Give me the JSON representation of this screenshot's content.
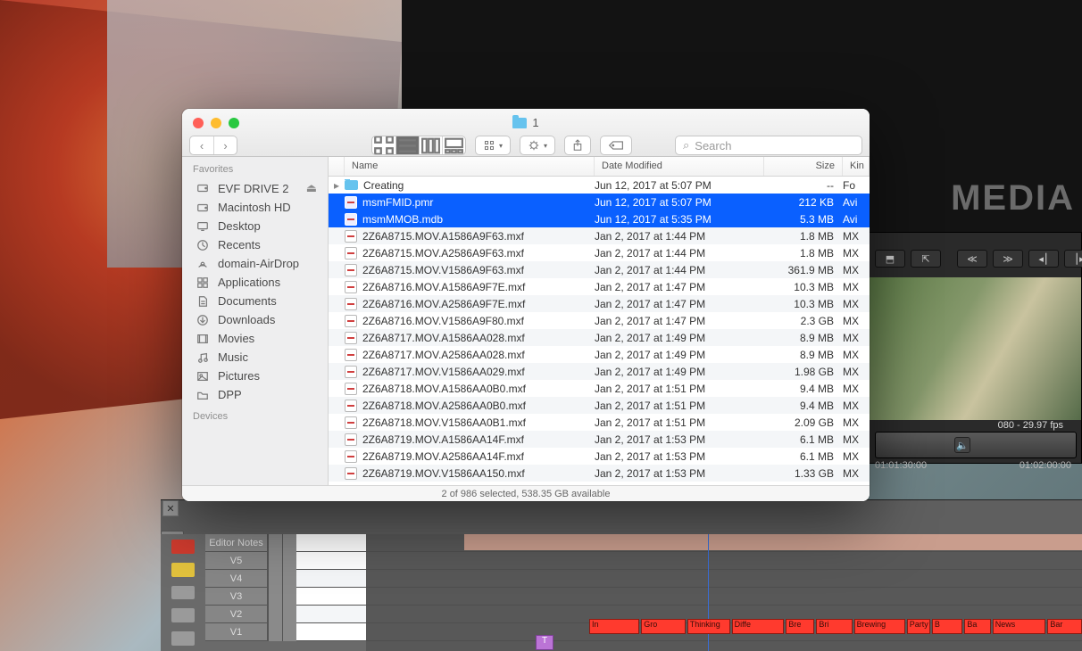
{
  "media_label": "MEDIA",
  "viewer": {
    "format": "080 - 29.97 fps",
    "tc_start": "01:01:30:00",
    "tc_end": "01:02:00:00",
    "speaker_icon": "🔈"
  },
  "timeline": {
    "notes_label": "Editor Notes",
    "tracks": [
      "V5",
      "V4",
      "V3",
      "V2",
      "V1"
    ],
    "clips": [
      "In",
      "Gro",
      "Thinking",
      "Diffe",
      "Bre",
      "Bri",
      "Brewing",
      "Party",
      "B",
      "Ba",
      "News",
      "Bar"
    ],
    "t_marker": "T"
  },
  "finder": {
    "title": "1",
    "search_placeholder": "Search",
    "nav": {
      "back": "‹",
      "fwd": "›"
    },
    "view_modes": {
      "icon_grid": "grid",
      "icon_list": "list",
      "icon_cols": "columns",
      "icon_gallery": "gallery"
    },
    "arrange_label": "Arrange",
    "action_label": "Action",
    "share_label": "Share",
    "tags_label": "Tags",
    "sidebar": {
      "favorites_label": "Favorites",
      "devices_label": "Devices",
      "items": [
        {
          "icon": "drive",
          "label": "EVF DRIVE 2",
          "eject": true
        },
        {
          "icon": "drive",
          "label": "Macintosh HD"
        },
        {
          "icon": "desktop",
          "label": "Desktop"
        },
        {
          "icon": "recents",
          "label": "Recents"
        },
        {
          "icon": "airdrop",
          "label": "domain-AirDrop"
        },
        {
          "icon": "apps",
          "label": "Applications"
        },
        {
          "icon": "docs",
          "label": "Documents"
        },
        {
          "icon": "downloads",
          "label": "Downloads"
        },
        {
          "icon": "movies",
          "label": "Movies"
        },
        {
          "icon": "music",
          "label": "Music"
        },
        {
          "icon": "pictures",
          "label": "Pictures"
        },
        {
          "icon": "folder",
          "label": "DPP"
        }
      ]
    },
    "columns": {
      "name": "Name",
      "date": "Date Modified",
      "size": "Size",
      "kind": "Kin"
    },
    "rows": [
      {
        "folder": true,
        "disclosure": true,
        "name": "Creating",
        "date": "Jun 12, 2017 at 5:07 PM",
        "size": "--",
        "kind": "Fo"
      },
      {
        "sel": true,
        "name": "msmFMID.pmr",
        "date": "Jun 12, 2017 at 5:07 PM",
        "size": "212 KB",
        "kind": "Avi"
      },
      {
        "sel": true,
        "name": "msmMMOB.mdb",
        "date": "Jun 12, 2017 at 5:35 PM",
        "size": "5.3 MB",
        "kind": "Avi"
      },
      {
        "name": "2Z6A8715.MOV.A1586A9F63.mxf",
        "date": "Jan 2, 2017 at 1:44 PM",
        "size": "1.8 MB",
        "kind": "MX"
      },
      {
        "name": "2Z6A8715.MOV.A2586A9F63.mxf",
        "date": "Jan 2, 2017 at 1:44 PM",
        "size": "1.8 MB",
        "kind": "MX"
      },
      {
        "name": "2Z6A8715.MOV.V1586A9F63.mxf",
        "date": "Jan 2, 2017 at 1:44 PM",
        "size": "361.9 MB",
        "kind": "MX"
      },
      {
        "name": "2Z6A8716.MOV.A1586A9F7E.mxf",
        "date": "Jan 2, 2017 at 1:47 PM",
        "size": "10.3 MB",
        "kind": "MX"
      },
      {
        "name": "2Z6A8716.MOV.A2586A9F7E.mxf",
        "date": "Jan 2, 2017 at 1:47 PM",
        "size": "10.3 MB",
        "kind": "MX"
      },
      {
        "name": "2Z6A8716.MOV.V1586A9F80.mxf",
        "date": "Jan 2, 2017 at 1:47 PM",
        "size": "2.3 GB",
        "kind": "MX"
      },
      {
        "name": "2Z6A8717.MOV.A1586AA028.mxf",
        "date": "Jan 2, 2017 at 1:49 PM",
        "size": "8.9 MB",
        "kind": "MX"
      },
      {
        "name": "2Z6A8717.MOV.A2586AA028.mxf",
        "date": "Jan 2, 2017 at 1:49 PM",
        "size": "8.9 MB",
        "kind": "MX"
      },
      {
        "name": "2Z6A8717.MOV.V1586AA029.mxf",
        "date": "Jan 2, 2017 at 1:49 PM",
        "size": "1.98 GB",
        "kind": "MX"
      },
      {
        "name": "2Z6A8718.MOV.A1586AA0B0.mxf",
        "date": "Jan 2, 2017 at 1:51 PM",
        "size": "9.4 MB",
        "kind": "MX"
      },
      {
        "name": "2Z6A8718.MOV.A2586AA0B0.mxf",
        "date": "Jan 2, 2017 at 1:51 PM",
        "size": "9.4 MB",
        "kind": "MX"
      },
      {
        "name": "2Z6A8718.MOV.V1586AA0B1.mxf",
        "date": "Jan 2, 2017 at 1:51 PM",
        "size": "2.09 GB",
        "kind": "MX"
      },
      {
        "name": "2Z6A8719.MOV.A1586AA14F.mxf",
        "date": "Jan 2, 2017 at 1:53 PM",
        "size": "6.1 MB",
        "kind": "MX"
      },
      {
        "name": "2Z6A8719.MOV.A2586AA14F.mxf",
        "date": "Jan 2, 2017 at 1:53 PM",
        "size": "6.1 MB",
        "kind": "MX"
      },
      {
        "name": "2Z6A8719.MOV.V1586AA150.mxf",
        "date": "Jan 2, 2017 at 1:53 PM",
        "size": "1.33 GB",
        "kind": "MX"
      }
    ],
    "status": "2 of 986 selected, 538.35 GB available"
  }
}
